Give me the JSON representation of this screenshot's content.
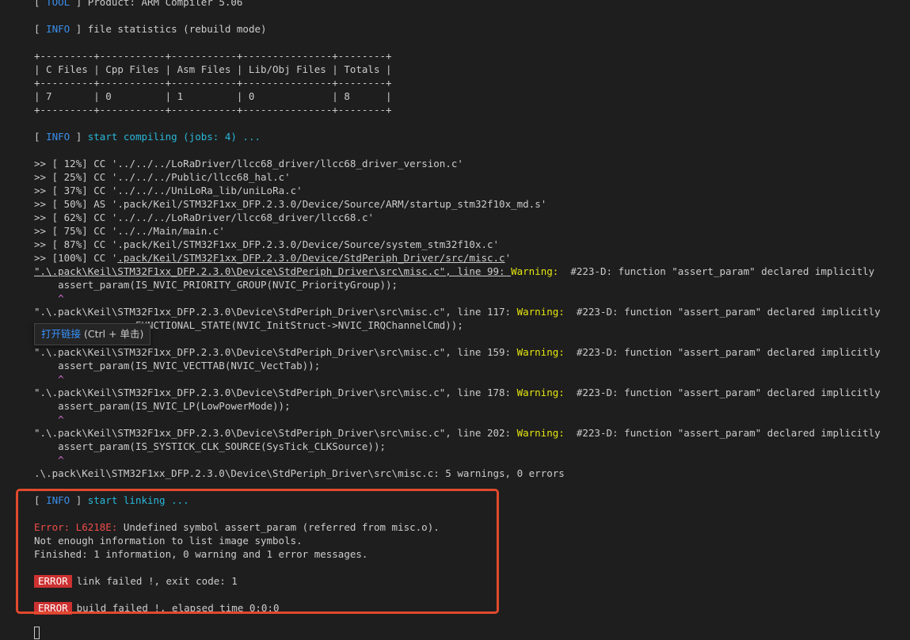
{
  "colors": {
    "background": "#1e1e1e",
    "text": "#cccccc",
    "info": "#3b8eea",
    "cyan": "#29b8db",
    "warning": "#e5e510",
    "error": "#f14c4c",
    "badge": "#cd3131",
    "highlight_box": "#e04a2e"
  },
  "tags": {
    "tool": "TOOL",
    "info": "INFO",
    "warning": "Warning:",
    "error_badge": "ERROR"
  },
  "header": {
    "tool_text": " Product: ARM Compiler 5.06",
    "file_stats_text": " file statistics (rebuild mode)"
  },
  "table": {
    "border": "+---------+-----------+-----------+---------------+--------+",
    "header_row": "| C Files | Cpp Files | Asm Files | Lib/Obj Files | Totals |",
    "value_row": "| 7       | 0         | 1         | 0             | 8      |"
  },
  "compile": {
    "message": "start compiling (jobs: 4) ...",
    "steps": [
      {
        "pct": "12%",
        "kind": "CC",
        "file": "'../../../LoRaDriver/llcc68_driver/llcc68_driver_version.c'"
      },
      {
        "pct": "25%",
        "kind": "CC",
        "file": "'../../../Public/llcc68_hal.c'"
      },
      {
        "pct": "37%",
        "kind": "CC",
        "file": "'../../../UniLoRa_lib/uniLoRa.c'"
      },
      {
        "pct": "50%",
        "kind": "AS",
        "file": "'.pack/Keil/STM32F1xx_DFP.2.3.0/Device/Source/ARM/startup_stm32f10x_md.s'"
      },
      {
        "pct": "62%",
        "kind": "CC",
        "file": "'../../../LoRaDriver/llcc68_driver/llcc68.c'"
      },
      {
        "pct": "75%",
        "kind": "CC",
        "file": "'../../Main/main.c'"
      },
      {
        "pct": "87%",
        "kind": "CC",
        "file": "'.pack/Keil/STM32F1xx_DFP.2.3.0/Device/Source/system_stm32f10x.c'"
      }
    ],
    "last_step": {
      "pct": "100%",
      "kind": "CC",
      "file_prefix": "'",
      "file_link": ".pack/Keil/STM32F1xx_DFP.2.3.0/Device/StdPeriph_Driver/src/misc.c",
      "file_suffix": "'"
    }
  },
  "warnings": [
    {
      "location": "\".\\.pack\\Keil\\STM32F1xx_DFP.2.3.0\\Device\\StdPeriph_Driver\\src\\misc.c\", line 99: ",
      "message": "  #223-D: function \"assert_param\" declared implicitly",
      "code": "    assert_param(IS_NVIC_PRIORITY_GROUP(NVIC_PriorityGroup));",
      "caret": "    ^"
    },
    {
      "location": "\".\\.pack\\Keil\\STM32F1xx_DFP.2.3.0\\Device\\StdPeriph_Driver\\src\\misc.c\", line 117: ",
      "message": "  #223-D: function \"assert_param\" declared implicitly",
      "code": "                 FUNCTIONAL_STATE(NVIC_InitStruct->NVIC_IRQChannelCmd));",
      "caret": ""
    },
    {
      "location": "\".\\.pack\\Keil\\STM32F1xx_DFP.2.3.0\\Device\\StdPeriph_Driver\\src\\misc.c\", line 159: ",
      "message": "  #223-D: function \"assert_param\" declared implicitly",
      "code": "    assert_param(IS_NVIC_VECTTAB(NVIC_VectTab));",
      "caret": "    ^"
    },
    {
      "location": "\".\\.pack\\Keil\\STM32F1xx_DFP.2.3.0\\Device\\StdPeriph_Driver\\src\\misc.c\", line 178: ",
      "message": "  #223-D: function \"assert_param\" declared implicitly",
      "code": "    assert_param(IS_NVIC_LP(LowPowerMode));",
      "caret": "    ^"
    },
    {
      "location": "\".\\.pack\\Keil\\STM32F1xx_DFP.2.3.0\\Device\\StdPeriph_Driver\\src\\misc.c\", line 202: ",
      "message": "  #223-D: function \"assert_param\" declared implicitly",
      "code": "    assert_param(IS_SYSTICK_CLK_SOURCE(SysTick_CLKSource));",
      "caret": "    ^"
    }
  ],
  "warnings_summary": ".\\.pack\\Keil\\STM32F1xx_DFP.2.3.0\\Device\\StdPeriph_Driver\\src\\misc.c: 5 warnings, 0 errors",
  "tooltip": {
    "link_text": "打开链接",
    "hint": " (Ctrl + 单击)"
  },
  "linking": {
    "message": "start linking ...",
    "error_label": "Error: L6218E:",
    "error_text": " Undefined symbol assert_param (referred from misc.o).",
    "line2": "Not enough information to list image symbols.",
    "line3": "Finished: 1 information, 0 warning and 1 error messages.",
    "link_failed": "link failed !, exit code: 1",
    "build_failed": "build failed !, elapsed time 0:0:0"
  }
}
